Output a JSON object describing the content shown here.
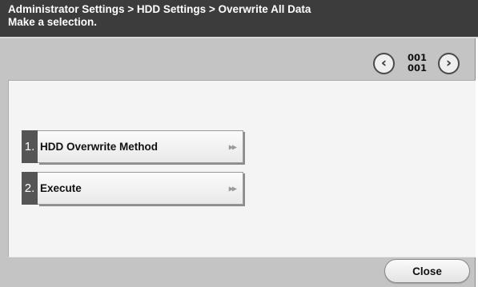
{
  "header": {
    "breadcrumb": "Administrator Settings > HDD Settings > Overwrite All Data",
    "instruction": "Make a selection."
  },
  "pagination": {
    "current": "001",
    "total": "001",
    "prev_icon": "circle-chevron-left-icon",
    "next_icon": "circle-chevron-right-icon"
  },
  "menu": {
    "items": [
      {
        "number": "1.",
        "label": "HDD Overwrite Method",
        "icon": "double-arrow-right-icon"
      },
      {
        "number": "2.",
        "label": "Execute",
        "icon": "double-arrow-right-icon"
      }
    ]
  },
  "footer": {
    "close_label": "Close"
  },
  "colors": {
    "header_bg": "#3c3c3c",
    "content_bg": "#c4c4c4",
    "list_bg": "#f4f4f4",
    "number_badge": "#555555"
  }
}
